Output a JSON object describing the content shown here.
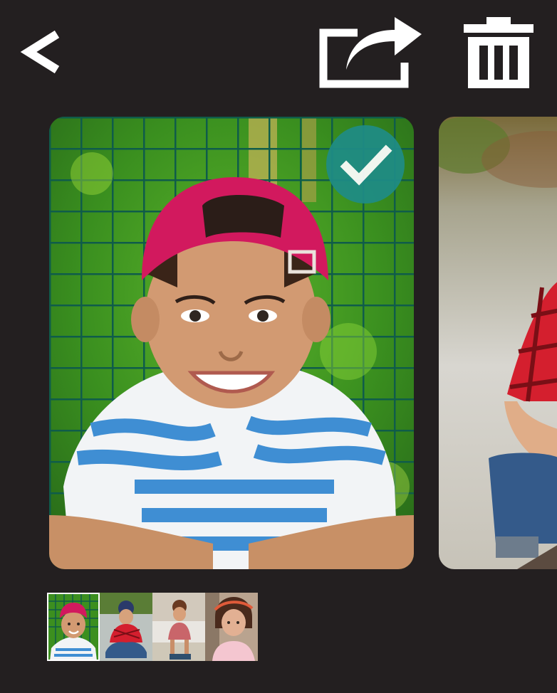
{
  "toolbar": {
    "back_icon": "chevron-left-icon",
    "share_icon": "share-icon",
    "delete_icon": "trash-icon",
    "back_label": "Back",
    "share_label": "Share",
    "delete_label": "Delete"
  },
  "gallery": {
    "selected_index": 0,
    "check_icon": "checkmark-icon",
    "photos": [
      {
        "subject": "boy-red-cap",
        "selected": true
      },
      {
        "subject": "boy-plaid-shirt",
        "selected": false
      }
    ],
    "thumbnails": [
      {
        "subject": "boy-red-cap",
        "selected": true
      },
      {
        "subject": "boy-red-plaid",
        "selected": false
      },
      {
        "subject": "girl-pink-shirt",
        "selected": false
      },
      {
        "subject": "girl-headband",
        "selected": false
      }
    ]
  },
  "colors": {
    "background": "#231f20",
    "icon": "#ffffff",
    "accent": "#1f8c86",
    "cap": "#d2195e",
    "shirt_stripe": "#3f8ed3"
  }
}
